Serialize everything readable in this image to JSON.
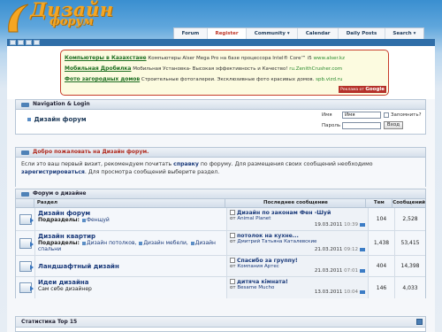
{
  "brand": {
    "line1": "Дизайн",
    "line2": "форум",
    "accent": "#f5a623"
  },
  "nav_tabs": [
    {
      "label": "Forum",
      "active": false
    },
    {
      "label": "Register",
      "active": true
    },
    {
      "label": "Community ▾",
      "active": false
    },
    {
      "label": "Calendar",
      "active": false
    },
    {
      "label": "Daily Posts",
      "active": false
    },
    {
      "label": "Search ▾",
      "active": false
    }
  ],
  "ads": {
    "rows": [
      {
        "title": "Компьютеры в Казахстане",
        "desc": " Компьютеры Alser Mega Pro на базе процессора Intel® Core™ i5 ",
        "url": "www.alser.kz"
      },
      {
        "title": "Мобильная Дробилка",
        "desc": " Мобильная Установка- Высокая эффективность и Качество! ",
        "url": "ru.ZenithCrusher.com"
      },
      {
        "title": "Фото загородных домов",
        "desc": " Строительные фотогалереи. Эксклюзивные фото красивых домов. ",
        "url": "spb.vizd.ru"
      }
    ],
    "badge_prefix": "Реклама от",
    "badge_brand": "Google"
  },
  "navlogin": {
    "header": "Navigation & Login",
    "title": "Дизайн форум",
    "username_label": "Имя",
    "username_value": "Имя",
    "remember_label": "Запомнить?",
    "password_label": "Пароль",
    "submit_label": "Вход"
  },
  "welcome": {
    "header": "Добро пожаловать на Дизайн форум.",
    "text1": "Если это ваш первый визит, рекомендуем почитать ",
    "link1": "справку",
    "text2": " по форуму. Для размещения своих сообщений необходимо ",
    "link2": "зарегистрироваться",
    "text3": ". Для просмотра сообщений выберите раздел."
  },
  "forums": {
    "header": "Форум о дизайне",
    "columns": {
      "forum": "Раздел",
      "last": "Последнее сообщение",
      "topics": "Тем",
      "posts": "Сообщений"
    },
    "rows": [
      {
        "title": "Дизайн форум",
        "sub_label": "Подразделы:",
        "subs": [
          "Фенщуй"
        ],
        "last_title": "Дизайн по законам Фен -Шуй",
        "last_by_prefix": "от",
        "last_user": "Animal Planet",
        "last_date": "19.03.2011",
        "last_time": "10:39",
        "topics": "104",
        "posts": "2,528"
      },
      {
        "title": "Дизайн квартир",
        "sub_label": "Подразделы:",
        "subs": [
          "Дизайн потолков,",
          "Дизайн мебели,",
          "Дизайн спальни"
        ],
        "last_title": "потолок на кухне...",
        "last_by_prefix": "от",
        "last_user": "Дмитрий Татьяна Каталевские",
        "last_date": "21.03.2011",
        "last_time": "09:12",
        "topics": "1,438",
        "posts": "53,415"
      },
      {
        "title": "Ландшафтный дизайн",
        "sub_label": "",
        "subs": [],
        "last_title": "Спасибо за группу!",
        "last_by_prefix": "от",
        "last_user": "Компания Артес",
        "last_date": "21.03.2011",
        "last_time": "07:01",
        "topics": "404",
        "posts": "14,398"
      },
      {
        "title": "Идеи дизайна",
        "sub_label": "Сам себе дизайнер",
        "subs": [],
        "last_title": "дитяча кімната!",
        "last_by_prefix": "от",
        "last_user": "Besame Mucho",
        "last_date": "13.03.2011",
        "last_time": "10:04",
        "topics": "146",
        "posts": "4,033"
      }
    ]
  },
  "stats": {
    "header": "Статистика Top 15"
  }
}
